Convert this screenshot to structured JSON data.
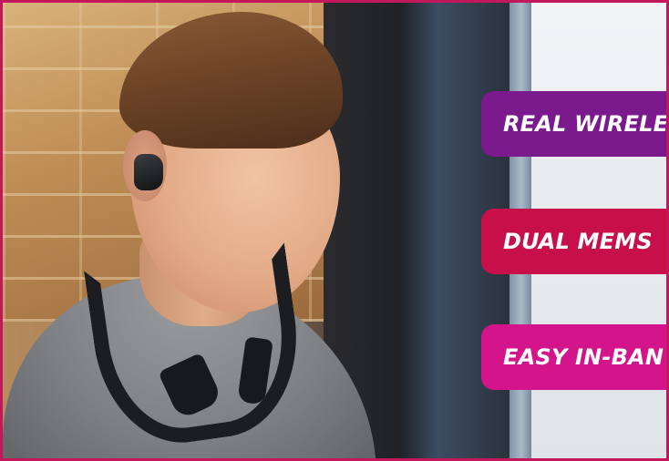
{
  "badges": [
    {
      "label": "REAL WIRELE",
      "color": "#7b1a8c"
    },
    {
      "label": "DUAL MEMS",
      "color": "#c7104a"
    },
    {
      "label": "EASY IN-BAN",
      "color": "#d4148a"
    }
  ],
  "frame": {
    "border_color": "#c2185b"
  },
  "image": {
    "subject": "person-wearing-neckband-earbuds-photo"
  }
}
